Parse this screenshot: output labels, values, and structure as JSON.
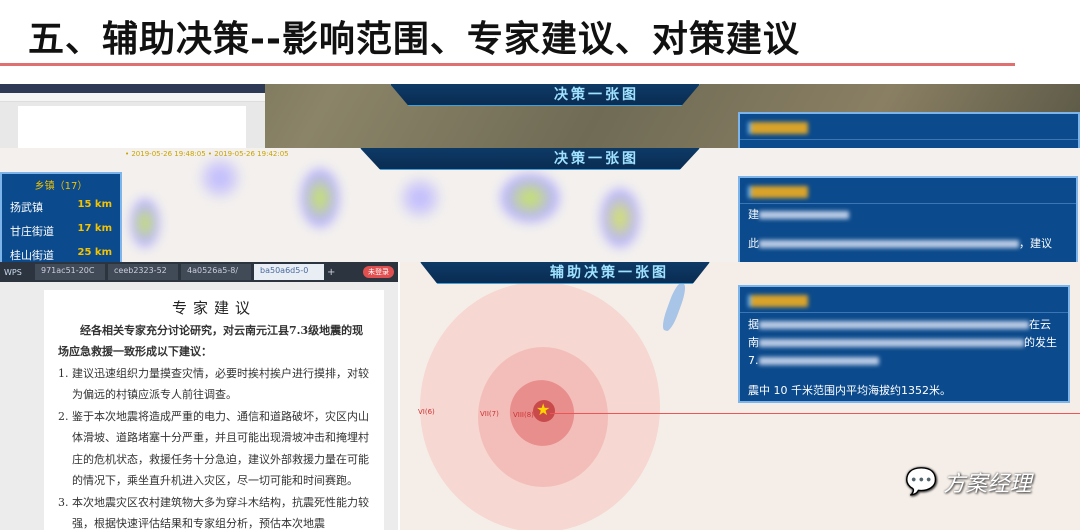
{
  "slide": {
    "title": "五、辅助决策--影响范围、专家建议、对策建议"
  },
  "layer1": {
    "banner": "决策一张图"
  },
  "layer2": {
    "banner": "决策一张图",
    "ticker": "• 2019-05-26 19:48:05 • 2019-05-26 19:42:05",
    "panel_title": "乡镇（17）",
    "towns": [
      {
        "name": "扬武镇",
        "dist": "15 km"
      },
      {
        "name": "甘庄街道",
        "dist": "17 km"
      },
      {
        "name": "桂山街道",
        "dist": "25 km"
      }
    ],
    "right_panel": {
      "line1": "建",
      "line2_start": "此",
      "line2_end": "，建议"
    }
  },
  "layer3": {
    "banner": "辅助决策一张图",
    "wps": {
      "app": "WPS",
      "tabs": [
        "971ac51-20C",
        "ceeb2323-52",
        "4a0526a5-8/",
        "ba50a6d5-0"
      ],
      "login": "未登录"
    },
    "doc": {
      "heading": "专家建议",
      "intro": "经各相关专家充分讨论研究，对云南元江县7.3级地震的现场应急救援一致形成以下建议：",
      "items": [
        "1. 建议迅速组织力量摸查灾情，必要时挨村挨户进行摸排，对较为偏远的村镇应派专人前往调查。",
        "2. 鉴于本次地震将造成严重的电力、通信和道路破坏，灾区内山体滑坡、道路堵塞十分严重，并且可能出现滑坡冲击和掩埋村庄的危机状态，救援任务十分急迫，建议外部救援力量在可能的情况下，乘坐直升机进入灾区，尽一切可能和时间赛跑。",
        "3. 本次地震灾区农村建筑物大多为穿斗木结构，抗震死性能力较强，根据快速评估结果和专家组分析，预估本次地震"
      ]
    },
    "map_labels": [
      "VI(6)",
      "VII(7)",
      "VIII(8)"
    ],
    "panel": {
      "p1": "据",
      "p1_end": "在云",
      "p2": "南",
      "p2_end": "的发生",
      "p3": "7.",
      "altitude": "震中 10 千米范围内平均海拔约1352米。"
    }
  },
  "watermark": "方案经理",
  "colors": {
    "panel": "#0b4a8c",
    "accent_line": "#e07070",
    "banner": "#0d3a66"
  }
}
